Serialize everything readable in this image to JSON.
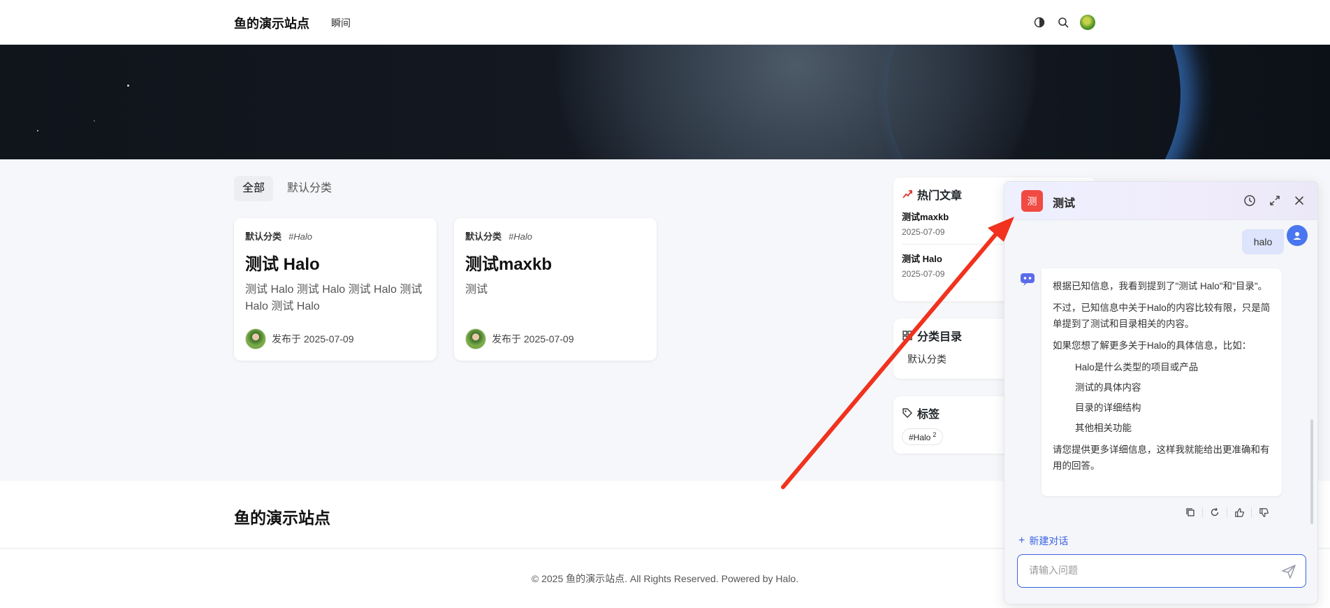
{
  "header": {
    "site_title": "鱼的演示站点",
    "nav": [
      "瞬间"
    ],
    "icons": [
      "theme-toggle-icon",
      "search-icon",
      "user-avatar"
    ]
  },
  "tabs": [
    {
      "label": "全部",
      "active": true
    },
    {
      "label": "默认分类",
      "active": false
    }
  ],
  "posts": [
    {
      "category": "默认分类",
      "tag": "#Halo",
      "title": "测试 Halo",
      "excerpt": "测试 Halo 测试 Halo 测试 Halo 测试 Halo 测试 Halo",
      "published": "发布于 2025-07-09"
    },
    {
      "category": "默认分类",
      "tag": "#Halo",
      "title": "测试maxkb",
      "excerpt": "测试",
      "published": "发布于 2025-07-09"
    }
  ],
  "sidebar": {
    "hot": {
      "title": "热门文章",
      "items": [
        {
          "title": "测试maxkb",
          "date": "2025-07-09"
        },
        {
          "title": "测试 Halo",
          "date": "2025-07-09"
        }
      ]
    },
    "categories": {
      "title": "分类目录",
      "items": [
        "默认分类"
      ]
    },
    "tags": {
      "title": "标签",
      "items": [
        {
          "label": "#Halo",
          "count": "2"
        }
      ]
    }
  },
  "footer": {
    "title": "鱼的演示站点",
    "copyright": "© 2025 鱼的演示站点. All Rights Reserved. Powered by Halo."
  },
  "chat": {
    "badge": "测",
    "name": "测试",
    "user_message": "halo",
    "bot_message": {
      "p1": "根据已知信息，我看到提到了\"测试 Halo\"和\"目录\"。",
      "p2": "不过，已知信息中关于Halo的内容比较有限，只是简单提到了测试和目录相关的内容。",
      "p3": "如果您想了解更多关于Halo的具体信息，比如：",
      "list": [
        "Halo是什么类型的项目或产品",
        "测试的具体内容",
        "目录的详细结构",
        "其他相关功能"
      ],
      "p4": "请您提供更多详细信息，这样我就能给出更准确和有用的回答。"
    },
    "new_chat": "新建对话",
    "input_placeholder": "请输入问题",
    "colors": {
      "accent": "#3a63e0",
      "badge": "#f04a42",
      "arrow": "#f0321e"
    }
  }
}
